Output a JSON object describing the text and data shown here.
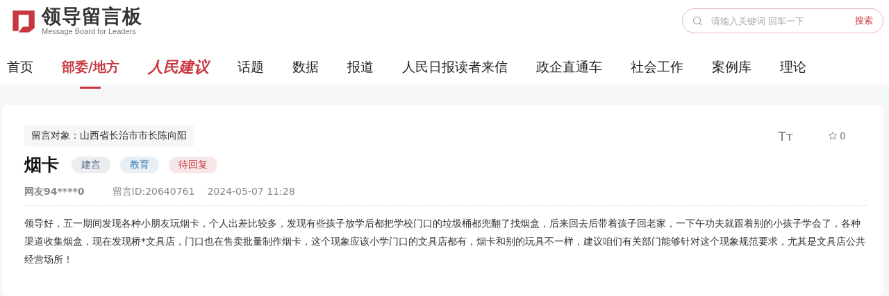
{
  "logo": {
    "title": "领导留言板",
    "subtitle": "Message Board for Leaders"
  },
  "search": {
    "placeholder": "请输入关键词 回车一下",
    "button": "搜索"
  },
  "nav": [
    {
      "label": "首页",
      "selected": false,
      "kind": "plain"
    },
    {
      "label": "部委/地方",
      "selected": true,
      "kind": "plain"
    },
    {
      "label": "人民建议",
      "selected": false,
      "kind": "brand"
    },
    {
      "label": "话题",
      "selected": false,
      "kind": "plain"
    },
    {
      "label": "数据",
      "selected": false,
      "kind": "plain"
    },
    {
      "label": "报道",
      "selected": false,
      "kind": "plain"
    },
    {
      "label": "人民日报读者来信",
      "selected": false,
      "kind": "plain"
    },
    {
      "label": "政企直通车",
      "selected": false,
      "kind": "plain"
    },
    {
      "label": "社会工作",
      "selected": false,
      "kind": "plain"
    },
    {
      "label": "案例库",
      "selected": false,
      "kind": "plain"
    },
    {
      "label": "理论",
      "selected": false,
      "kind": "plain"
    }
  ],
  "message": {
    "recipient": "留言对象：山西省长治市市长陈向阳",
    "font_size_button": "Tт",
    "favorites": "0",
    "title": "烟卡",
    "tags": [
      {
        "label": "建言",
        "color": "#5a6a8c"
      },
      {
        "label": "教育",
        "color": "#3f7fb0"
      },
      {
        "label": "待回复",
        "color": "#c8363f"
      }
    ],
    "author": "网友94****0",
    "id": "留言ID:20640761",
    "time": "2024-05-07 11:28",
    "body": "领导好，五一期间发现各种小朋友玩烟卡，个人出差比较多，发现有些孩子放学后都把学校门口的垃圾桶都兜翻了找烟盒，后来回去后带着孩子回老家，一下午功夫就跟着别的小孩子学会了，各种渠道收集烟盒，现在发现桥*文具店，门口也在售卖批量制作烟卡，这个现象应该小学门口的文具店都有，烟卡和别的玩具不一样，建议咱们有关部门能够针对这个现象规范要求，尤其是文具店公共经营场所！"
  }
}
